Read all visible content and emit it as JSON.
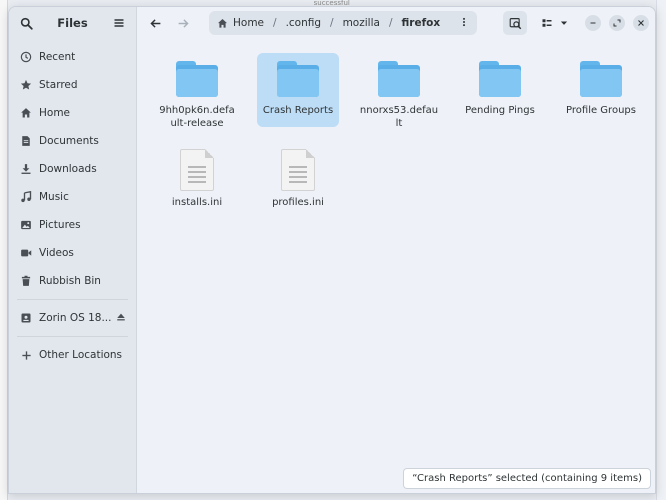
{
  "background": {
    "top_fragment": "_successful"
  },
  "sidebar": {
    "title": "Files",
    "items": [
      {
        "label": "Recent",
        "icon": "clock-icon"
      },
      {
        "label": "Starred",
        "icon": "star-icon"
      },
      {
        "label": "Home",
        "icon": "home-icon"
      },
      {
        "label": "Documents",
        "icon": "document-icon"
      },
      {
        "label": "Downloads",
        "icon": "download-icon"
      },
      {
        "label": "Music",
        "icon": "music-icon"
      },
      {
        "label": "Pictures",
        "icon": "picture-icon"
      },
      {
        "label": "Videos",
        "icon": "video-icon"
      },
      {
        "label": "Rubbish Bin",
        "icon": "trash-icon"
      }
    ],
    "device": {
      "label": "Zorin OS 18...",
      "icon": "drive-icon"
    },
    "other": {
      "label": "Other Locations",
      "icon": "plus-icon"
    }
  },
  "pathbar": {
    "crumbs": [
      "Home",
      ".config",
      "mozilla",
      "firefox"
    ]
  },
  "files": [
    {
      "label": "9hh0pk6n.default-release",
      "type": "folder",
      "selected": false
    },
    {
      "label": "Crash Reports",
      "type": "folder",
      "selected": true
    },
    {
      "label": "nnorxs53.default",
      "type": "folder",
      "selected": false
    },
    {
      "label": "Pending Pings",
      "type": "folder",
      "selected": false
    },
    {
      "label": "Profile Groups",
      "type": "folder",
      "selected": false
    },
    {
      "label": "installs.ini",
      "type": "file",
      "selected": false
    },
    {
      "label": "profiles.ini",
      "type": "file",
      "selected": false
    }
  ],
  "status": "“Crash Reports” selected  (containing 9 items)",
  "colors": {
    "folder": "#82c7f3",
    "selection": "#bddcf5"
  }
}
